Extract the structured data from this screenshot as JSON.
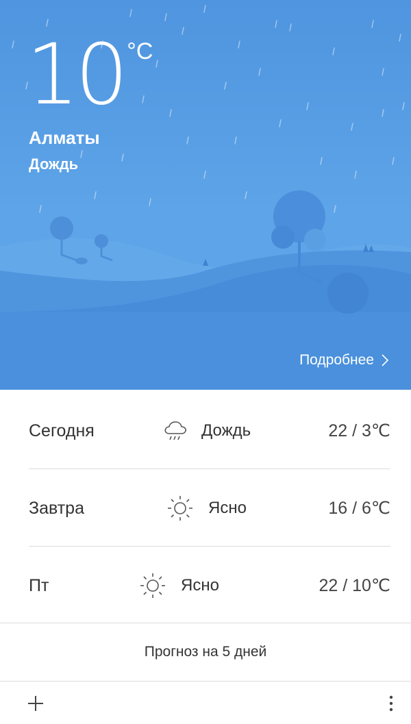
{
  "current": {
    "temperature": "10",
    "unit": "°C",
    "city": "Алматы",
    "condition": "Дождь",
    "details_label": "Подробнее"
  },
  "forecast": [
    {
      "day": "Сегодня",
      "condition": "Дождь",
      "icon": "cloud-rain-icon",
      "temps": "22 / 3℃"
    },
    {
      "day": "Завтра",
      "condition": "Ясно",
      "icon": "sun-icon",
      "temps": "16 / 6℃"
    },
    {
      "day": "Пт",
      "condition": "Ясно",
      "icon": "sun-icon",
      "temps": "22 / 10℃"
    }
  ],
  "five_day_label": "Прогноз на 5 дней",
  "bottom_bar": {
    "add_icon": "plus-icon",
    "menu_icon": "more-vertical-icon"
  },
  "colors": {
    "sky_top": "#4f95df",
    "sky_bottom": "#5aa3e8",
    "hill_back": "#64aaeb",
    "hill_front": "#4a8fdb",
    "text_primary": "#333333",
    "divider": "#dcdcdc"
  }
}
